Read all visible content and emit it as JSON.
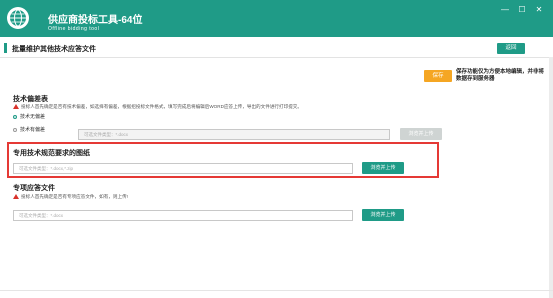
{
  "window": {
    "title": "供应商投标工具-64位",
    "subtitle": "Offline bidding tool",
    "controls": {
      "minimize": "—",
      "maximize": "☐",
      "close": "✕"
    }
  },
  "header": {
    "title": "批量维护其他技术应答文件",
    "back_label": "返回"
  },
  "save": {
    "label": "保存",
    "note": "保存功能仅为方便本地编辑，并非将数据存到服务器"
  },
  "section1": {
    "title": "技术偏差表",
    "note": "投标人首先确定是否有技术偏差，如选择有偏差，根据招投标文件格式，填写完成后将编辑后WORD应答上传，导出的文件进行打印提交。",
    "option_no": "技术无偏差",
    "option_yes": "技术有偏差",
    "placeholder": "可选文件类型：*.docx",
    "upload_label": "浏览并上传"
  },
  "section2": {
    "title": "专用技术规范要求的图纸",
    "placeholder": "可选文件类型：*.docx,*.zip",
    "upload_label": "浏览并上传"
  },
  "section3": {
    "title": "专项应答文件",
    "note": "投标人首先确定是否有专项应答文件，如有，则上传!",
    "placeholder": "可选文件类型：*.docx",
    "upload_label": "浏览并上传"
  },
  "colors": {
    "primary": "#1f9b87",
    "save": "#f5a623",
    "highlight": "#e53935",
    "warning": "#d9322b"
  },
  "icons": {
    "logo": "globe-logo-icon",
    "warning": "warning-triangle-icon"
  }
}
